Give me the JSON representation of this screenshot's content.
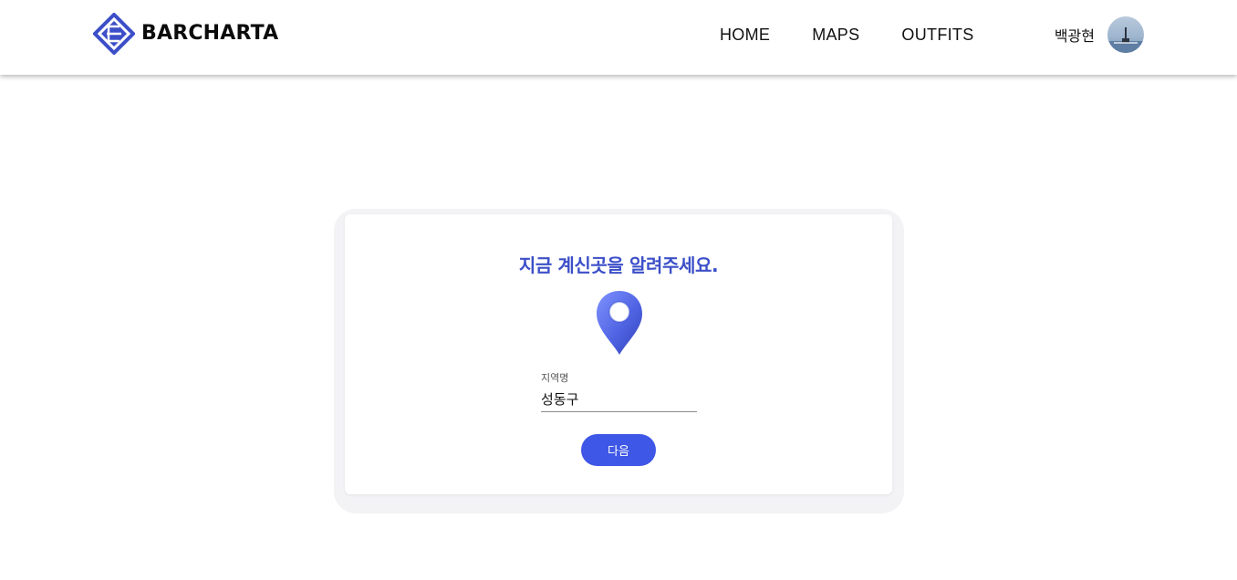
{
  "header": {
    "logo_text": "BARCHARTA",
    "nav": [
      {
        "label": "HOME"
      },
      {
        "label": "MAPS"
      },
      {
        "label": "OUTFITS"
      }
    ],
    "user_name": "백광현"
  },
  "card": {
    "title": "지금 계신곳을 알려주세요.",
    "field": {
      "label": "지역명",
      "value": "성동구",
      "placeholder": ""
    },
    "next_label": "다음"
  },
  "colors": {
    "brand": "#3c4fc8",
    "button": "#3f57e6",
    "pin": "#4f63e0"
  },
  "icons": {
    "logo": "diamond-e-logo-icon",
    "pin": "location-pin-icon",
    "avatar": "user-avatar"
  }
}
